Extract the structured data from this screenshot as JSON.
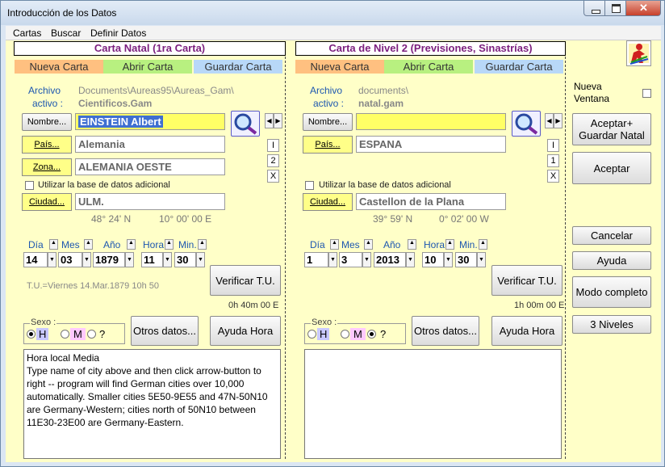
{
  "window": {
    "title": "Introducción de los Datos"
  },
  "menu": {
    "items": [
      "Cartas",
      "Buscar",
      "Definir Datos"
    ]
  },
  "natal": {
    "header": "Carta Natal (1ra Carta)",
    "tabs": {
      "new": "Nueva Carta",
      "open": "Abrir Carta",
      "save": "Guardar Carta"
    },
    "archivo_label": "Archivo",
    "activo_label": "activo :",
    "path": "Documents\\Aureas95\\Aureas_Gam\\",
    "file": "Cientificos.Gam",
    "nombre_btn": "Nombre...",
    "nombre": "EINSTEIN Albert",
    "pais_btn": "País...",
    "pais": "Alemania",
    "zona_btn": "Zona...",
    "zona": "ALEMANIA OESTE",
    "db_label": "Utilizar la base de datos adicional",
    "ciudad_btn": "Ciudad...",
    "ciudad": "ULM.",
    "lat": "48° 24' N",
    "lon": "10° 00' 00 E",
    "side_btns": [
      "I",
      "2",
      "X"
    ],
    "date_labels": {
      "dia": "Día",
      "mes": "Mes",
      "ano": "Año",
      "hora": "Hora",
      "min": "Min."
    },
    "date": {
      "dia": "14",
      "mes": "03",
      "ano": "1879",
      "hora": "11",
      "min": "30"
    },
    "tu_info": "T.U.=Viernes 14.Mar.1879 10h 50",
    "verify_btn": "Verificar T.U.",
    "tu_offset": "0h 40m 00 E",
    "sexo_label": "Sexo :",
    "sex_options": [
      "H",
      "M",
      "?"
    ],
    "otros_btn": "Otros datos...",
    "ayuda_hora_btn": "Ayuda Hora",
    "notes": "Hora local Media\nType name of city above and then click arrow-button to right -- program will find German cities over 10,000 automatically. Smaller cities 5E50-9E55 and 47N-50N10 are Germany-Western; cities north of 50N10 between 11E30-23E00 are Germany-Eastern."
  },
  "level2": {
    "header": "Carta de Nivel 2 (Previsiones, Sinastrías)",
    "tabs": {
      "new": "Nueva Carta",
      "open": "Abrir Carta",
      "save": "Guardar Carta"
    },
    "archivo_label": "Archivo",
    "activo_label": "activo :",
    "path": "documents\\",
    "file": "natal.gam",
    "nombre_btn": "Nombre...",
    "nombre": "",
    "pais_btn": "País...",
    "pais": "ESPANA",
    "db_label": "Utilizar la base de datos adicional",
    "ciudad_btn": "Ciudad...",
    "ciudad": "Castellon de la Plana",
    "lat": "39° 59' N",
    "lon": "0° 02' 00 W",
    "side_btns": [
      "I",
      "1",
      "X"
    ],
    "date_labels": {
      "dia": "Día",
      "mes": "Mes",
      "ano": "Año",
      "hora": "Hora",
      "min": "Min."
    },
    "date": {
      "dia": "1",
      "mes": "3",
      "ano": "2013",
      "hora": "10",
      "min": "30"
    },
    "verify_btn": "Verificar T.U.",
    "tu_offset": "1h 00m 00 E",
    "sexo_label": "Sexo :",
    "sex_options": [
      "H",
      "M",
      "?"
    ],
    "otros_btn": "Otros datos...",
    "ayuda_hora_btn": "Ayuda Hora",
    "notes": ""
  },
  "right": {
    "nueva_ventana": "Nueva Ventana",
    "aceptar_guardar": "Aceptar+ Guardar Natal",
    "aceptar": "Aceptar",
    "cancelar": "Cancelar",
    "ayuda": "Ayuda",
    "modo": "Modo completo",
    "niveles": "3 Niveles"
  },
  "colors": {
    "panel": "#ffffc8",
    "header_text": "#7b1f7f",
    "tab_new": "#ffc080",
    "tab_open": "#b8f080",
    "tab_save": "#b8d8f8",
    "field_active": "#ffff66",
    "label_blue": "#1d57b0"
  }
}
